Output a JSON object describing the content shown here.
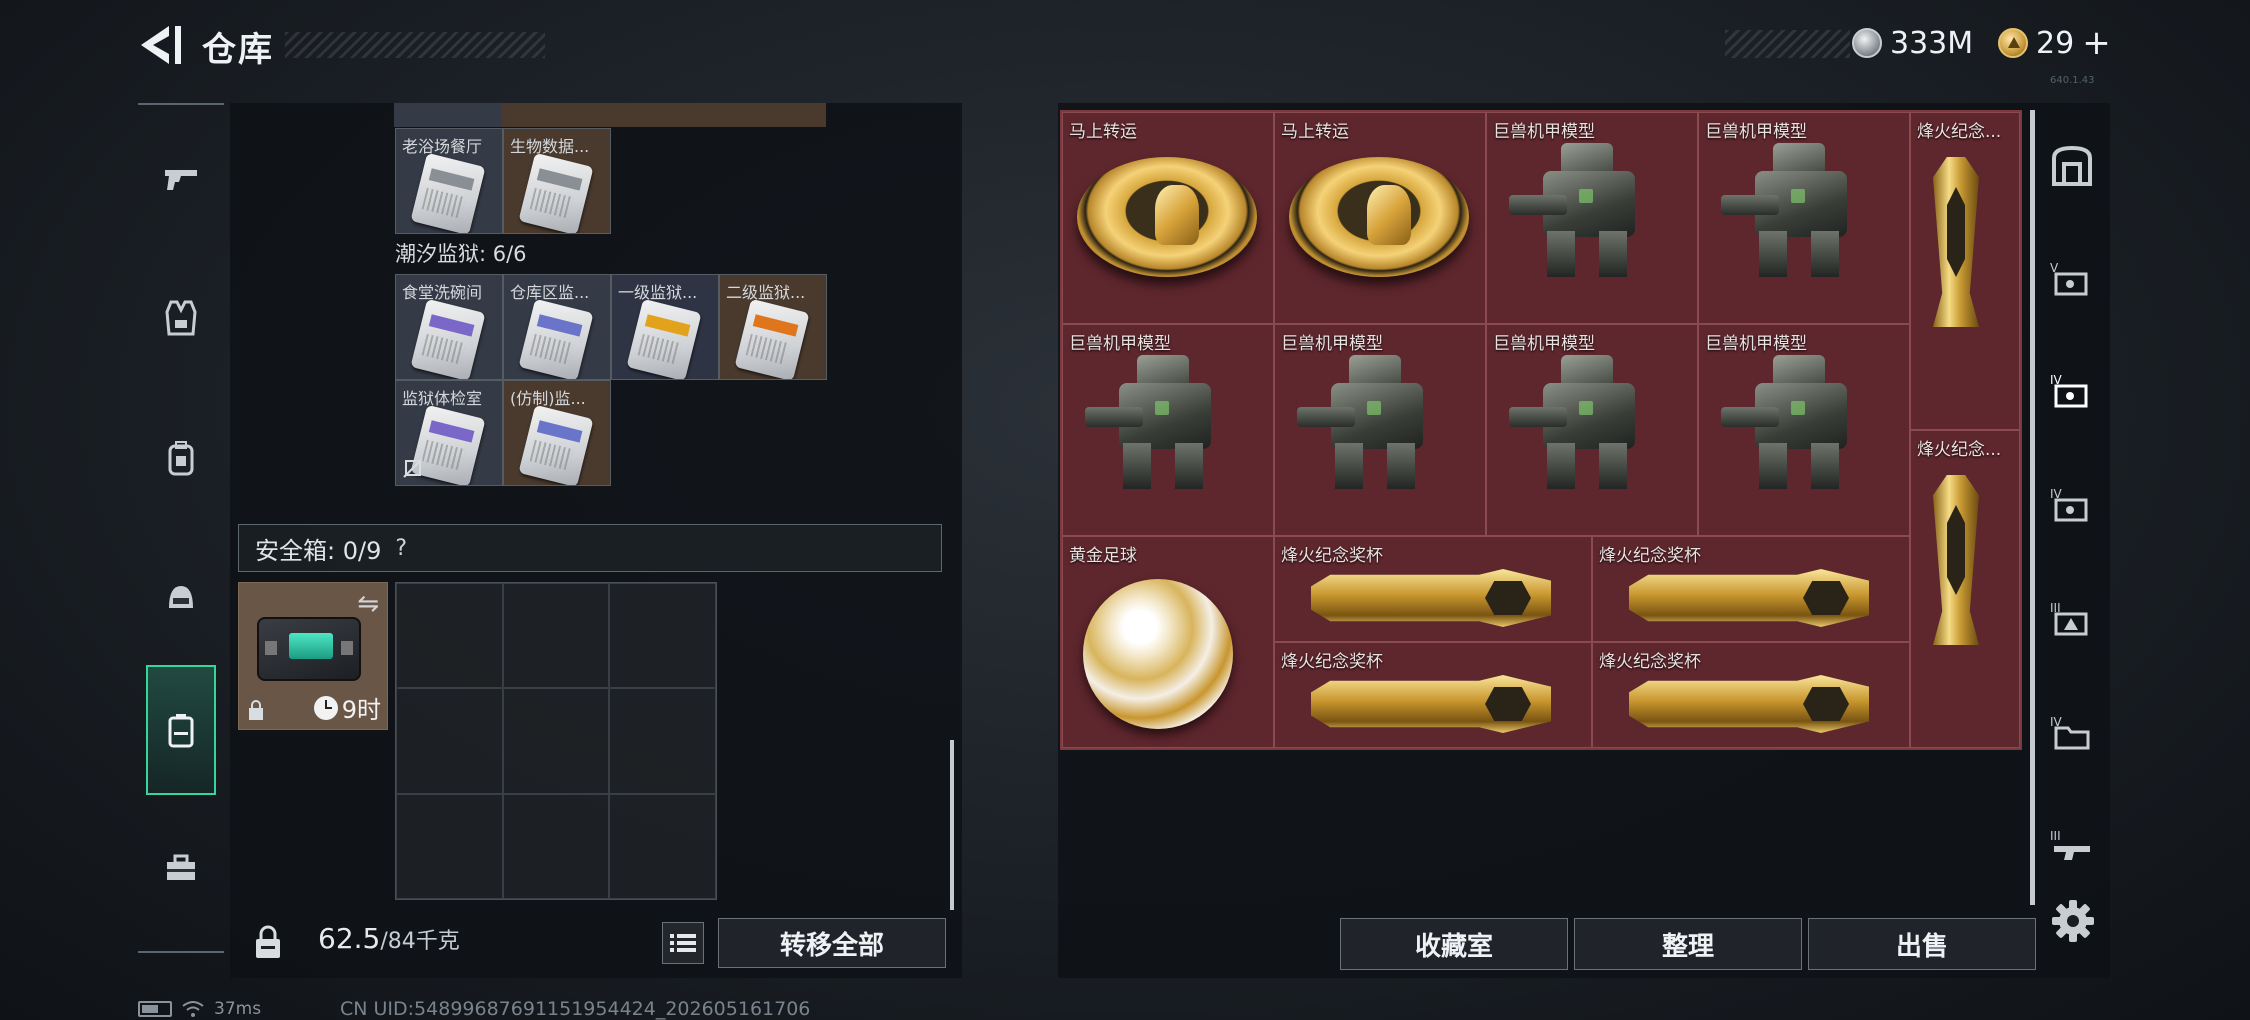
{
  "header": {
    "title": "仓库",
    "silver_amount": "333M",
    "gold_amount": "29",
    "gold_add": "+",
    "version": "640.1.43"
  },
  "left_panel": {
    "top_row_cards": [
      {
        "label": "老浴场餐厅",
        "bg": "gray"
      },
      {
        "label": "生物数据...",
        "bg": "brown"
      }
    ],
    "group_title": "潮汐监狱: 6/6",
    "group_cards": [
      {
        "label": "食堂洗碗间",
        "bg": "gray",
        "stripe": "#7a67c8"
      },
      {
        "label": "仓库区监...",
        "bg": "gray",
        "stripe": "#6a74c8"
      },
      {
        "label": "一级监狱...",
        "bg": "navy",
        "stripe": "#e2a21c"
      },
      {
        "label": "二级监狱...",
        "bg": "brown",
        "stripe": "#e0761c"
      },
      {
        "label": "监狱体检室",
        "bg": "gray",
        "stripe": "#7a67c8"
      },
      {
        "label": "(仿制)监...",
        "bg": "brown",
        "stripe": "#6a74c8"
      }
    ],
    "safe_box_label": "安全箱: 0/9",
    "safe_box_help": "?",
    "case_time": "9时",
    "weight_current": "62.5",
    "weight_max": "/84千克",
    "transfer_all": "转移全部"
  },
  "stash": {
    "items": [
      {
        "name": "马上转运",
        "kind": "plate"
      },
      {
        "name": "马上转运",
        "kind": "plate"
      },
      {
        "name": "巨兽机甲模型",
        "kind": "mech"
      },
      {
        "name": "巨兽机甲模型",
        "kind": "mech"
      },
      {
        "name": "烽火纪念...",
        "kind": "pillar"
      },
      {
        "name": "巨兽机甲模型",
        "kind": "mech"
      },
      {
        "name": "巨兽机甲模型",
        "kind": "mech"
      },
      {
        "name": "巨兽机甲模型",
        "kind": "mech"
      },
      {
        "name": "巨兽机甲模型",
        "kind": "mech"
      },
      {
        "name": "烽火纪念...",
        "kind": "pillar"
      },
      {
        "name": "黄金足球",
        "kind": "ball"
      },
      {
        "name": "烽火纪念奖杯",
        "kind": "htrophy"
      },
      {
        "name": "烽火纪念奖杯",
        "kind": "htrophy"
      },
      {
        "name": "烽火纪念奖杯",
        "kind": "htrophy"
      },
      {
        "name": "烽火纪念奖杯",
        "kind": "htrophy"
      }
    ]
  },
  "bottom_buttons": {
    "collection": "收藏室",
    "organize": "整理",
    "sell": "出售"
  },
  "status_bar": {
    "ping": "37ms",
    "uid": "CN UID:5489968769115195442​4_202605161706"
  }
}
